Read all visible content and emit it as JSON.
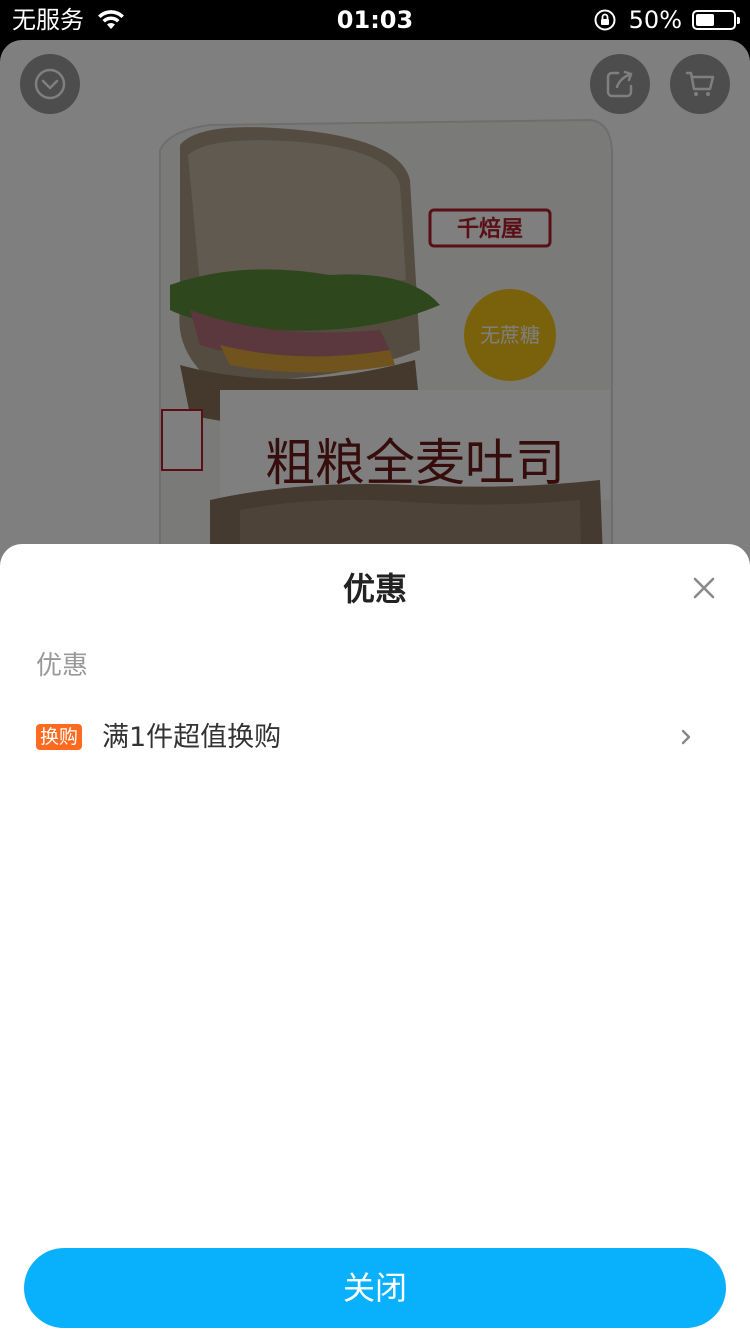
{
  "status_bar": {
    "carrier": "无服务",
    "time": "01:03",
    "battery_percent": "50%",
    "battery_level": 0.5
  },
  "product": {
    "brand": "千焙屋",
    "name": "粗粮全麦吐司",
    "badge": "无蔗糖"
  },
  "sheet": {
    "title": "优惠",
    "section_label": "优惠",
    "promotions": [
      {
        "badge": "换购",
        "text": "满1件超值换购"
      }
    ],
    "close_button": "关闭"
  },
  "colors": {
    "accent": "#09b1fd",
    "badge": "#ff6a1f"
  }
}
